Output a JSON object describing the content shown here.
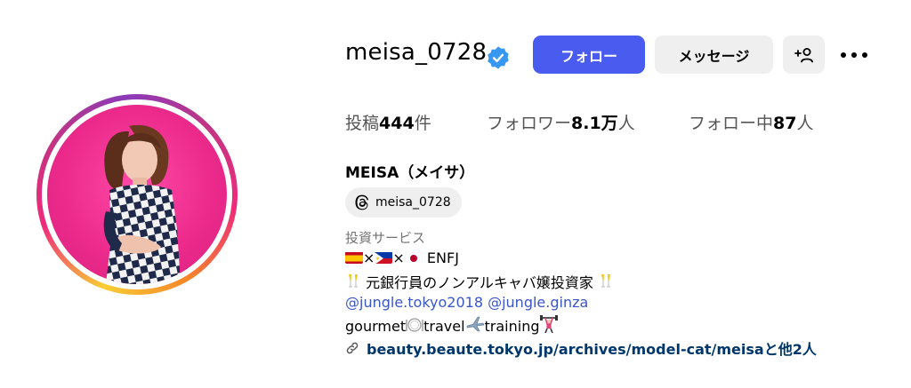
{
  "profile": {
    "username": "meisa_0728",
    "follow_label": "フォロー",
    "message_label": "メッセージ",
    "stats": {
      "posts_label": "投稿",
      "posts_count": "444",
      "posts_unit": "件",
      "followers_label": "フォロワー",
      "followers_count": "8.1万",
      "followers_unit": "人",
      "following_label": "フォロー中",
      "following_count": "87",
      "following_unit": "人"
    },
    "full_name": "MEISA（メイサ）",
    "threads_handle": "meisa_0728",
    "category": "投資サービス",
    "bio": {
      "line1_sep1": "×",
      "line1_sep2": "×",
      "line1_type": "ENFJ",
      "line2_text": "元銀行員のノンアルキャバ嬢投資家",
      "mention1": "@jungle.tokyo2018",
      "mention2": "@jungle.ginza",
      "line4_a": "gourmet",
      "line4_b": "travel",
      "line4_c": "training"
    },
    "link_text": "beauty.beaute.tokyo.jp/archives/model-cat/meisaと他2人"
  },
  "colors": {
    "follow_button": "#4a5cf0",
    "secondary_button": "#efefef",
    "mention": "#3a56c8",
    "link": "#00376b",
    "verified": "#3897f0",
    "avatar_bg": "#ec2b8c"
  },
  "icons": [
    "verified-badge-icon",
    "add-user-icon",
    "more-icon",
    "threads-icon",
    "link-icon"
  ]
}
